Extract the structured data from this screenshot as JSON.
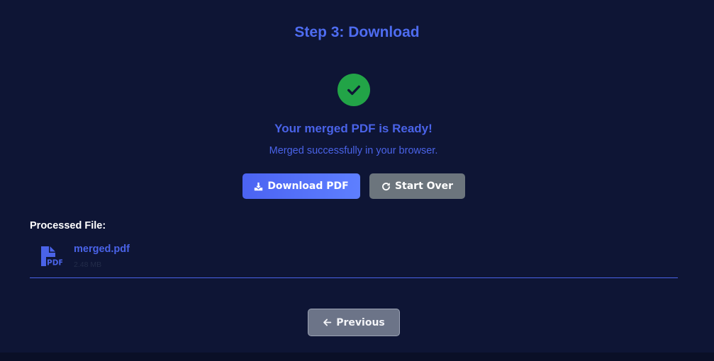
{
  "step": {
    "title": "Step 3: Download"
  },
  "status": {
    "icon": "check-circle-icon",
    "title": "Your merged PDF is Ready!",
    "subtitle": "Merged successfully in your browser."
  },
  "actions": {
    "download_label": "Download PDF",
    "download_icon": "download-icon",
    "start_over_label": "Start Over",
    "start_over_icon": "refresh-icon"
  },
  "processed": {
    "label": "Processed File:",
    "file": {
      "icon": "pdf-file-icon",
      "icon_text": "PDF",
      "name": "merged.pdf",
      "size": "2.48 MB"
    }
  },
  "nav": {
    "previous_label": "Previous",
    "previous_icon": "arrow-left-icon"
  },
  "colors": {
    "background": "#0e1535",
    "accent": "#4a63e8",
    "success": "#22a447",
    "secondary_button": "#6c757d"
  }
}
